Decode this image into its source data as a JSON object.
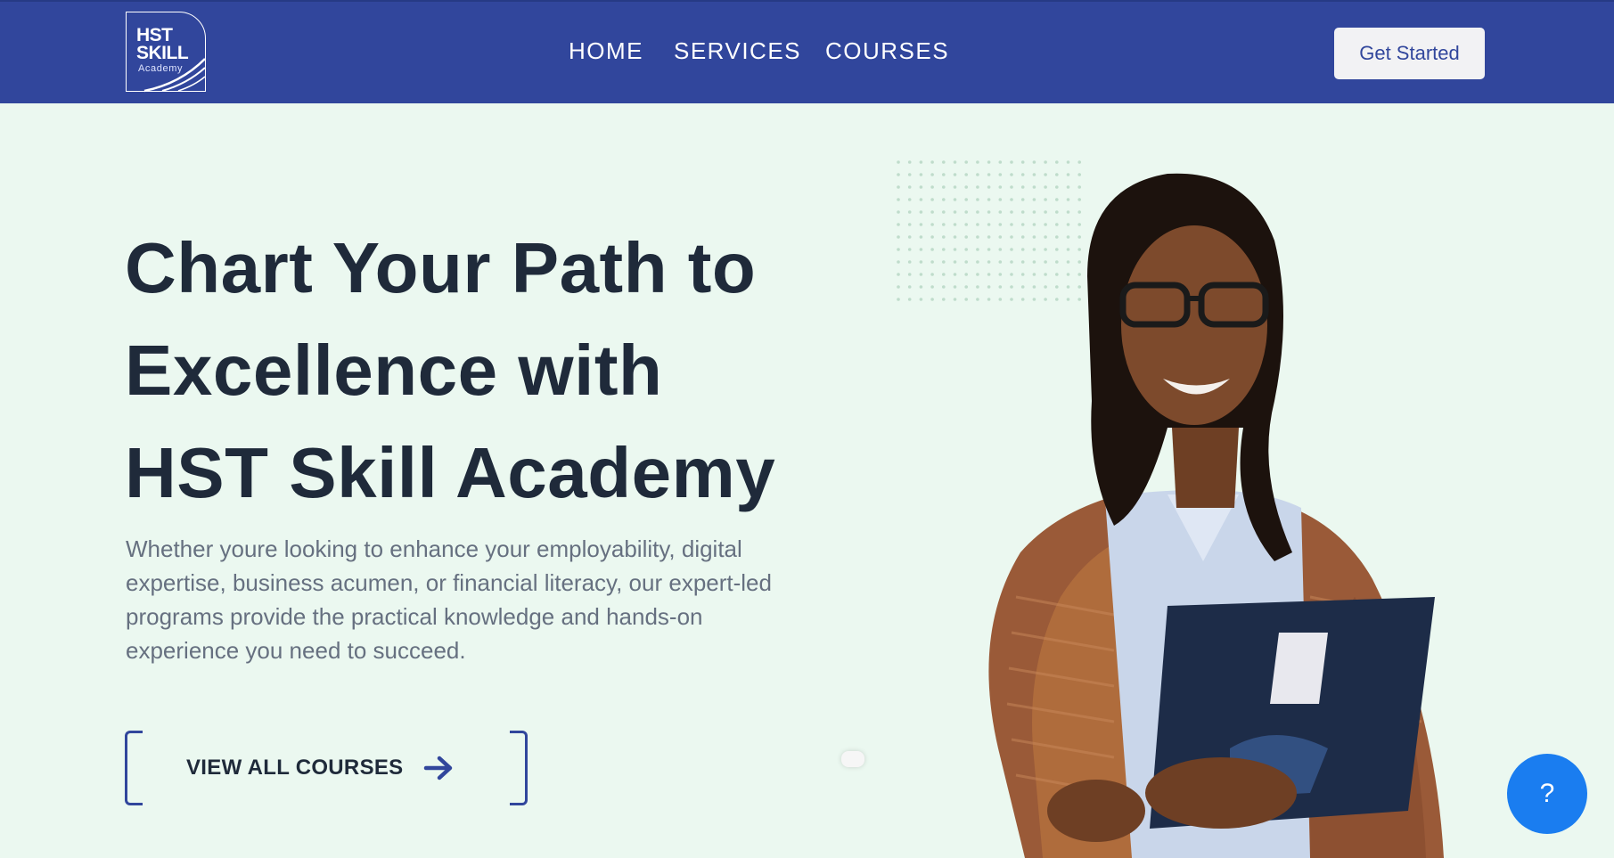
{
  "header": {
    "logo": {
      "line1": "HST",
      "line2": "SKILL",
      "line3": "Academy"
    },
    "nav": [
      {
        "label": "HOME"
      },
      {
        "label": "SERVICES"
      },
      {
        "label": "COURSES"
      }
    ],
    "cta_label": "Get Started"
  },
  "hero": {
    "title_lines": [
      "Chart Your Path to",
      "Excellence with",
      "HST Skill Academy"
    ],
    "description": "Whether youre looking to enhance your employability, digital expertise, business acumen, or financial literacy, our expert-led programs provide the practical knowledge and hands-on experience you need to succeed.",
    "cta_label": "VIEW ALL COURSES",
    "cta_icon": "arrow-right-icon"
  },
  "help": {
    "label": "?"
  },
  "colors": {
    "header_bg": "#31469c",
    "page_bg": "#ebf8f0",
    "heading": "#1f2a3a",
    "body_text": "#667080",
    "accent": "#31469c",
    "help_button": "#1a7df0"
  }
}
